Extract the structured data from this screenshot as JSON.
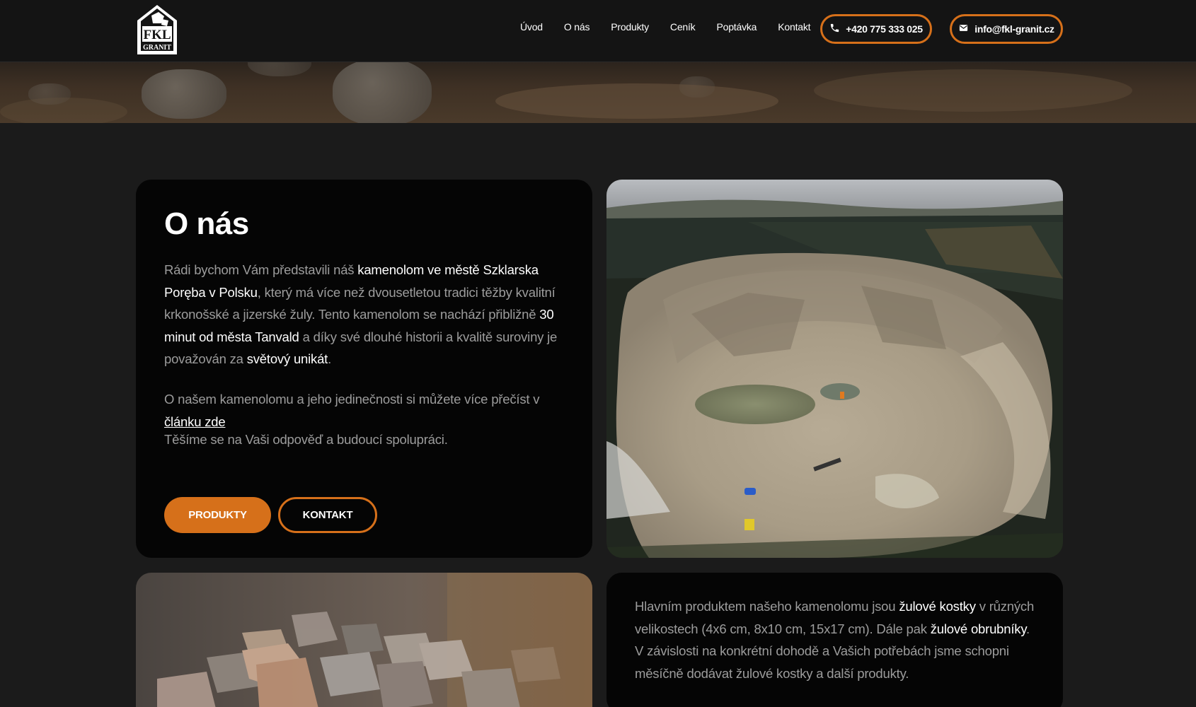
{
  "brand": {
    "logo_top": "FKL",
    "logo_bottom": "GRANIT"
  },
  "nav": {
    "items": [
      "Úvod",
      "O nás",
      "Produkty",
      "Ceník",
      "Poptávka",
      "Kontakt"
    ]
  },
  "contact": {
    "phone": "+420 775 333 025",
    "email": "info@fkl-granit.cz"
  },
  "about": {
    "title": "O nás",
    "p1": {
      "t1": "Rádi bychom Vám představili náš ",
      "h1": "kamenolom ve městě Szklarska Poręba v Polsku",
      "t2": ", který má více než dvousetletou tradici těžby kvalitní krkonošské a jizerské žuly. Tento kamenolom se nachází přibližně ",
      "h2": "30 minut od města Tanvald",
      "t3": " a díky své dlouhé historii a kvalitě suroviny je považován za ",
      "h3": "světový unikát",
      "t4": "."
    },
    "p2": {
      "t1": "O našem kamenolomu a jeho jedinečnosti si můžete více přečíst v ",
      "link": "článku zde"
    },
    "p3": "Těšíme se na Vaši odpověď a budoucí spolupráci.",
    "btn_products": "PRODUKTY",
    "btn_contact": "KONTAKT"
  },
  "products_text": {
    "t1": "Hlavním produktem našeho kamenolomu jsou ",
    "h1": "žulové kostky",
    "t2": " v různých velikostech (4x6 cm, 8x10 cm, 15x17 cm). Dále pak ",
    "h2": "žulové obrubníky",
    "t3": ". V závislosti na konkrétní dohodě a Vašich potřebách jsme schopni měsíčně dodávat žulové kostky a další produkty."
  },
  "colors": {
    "accent": "#d6701a",
    "card": "#050505",
    "page": "#1b1b1b",
    "header": "#141414"
  },
  "icons": {
    "phone": "phone-icon",
    "email": "envelope-icon"
  }
}
